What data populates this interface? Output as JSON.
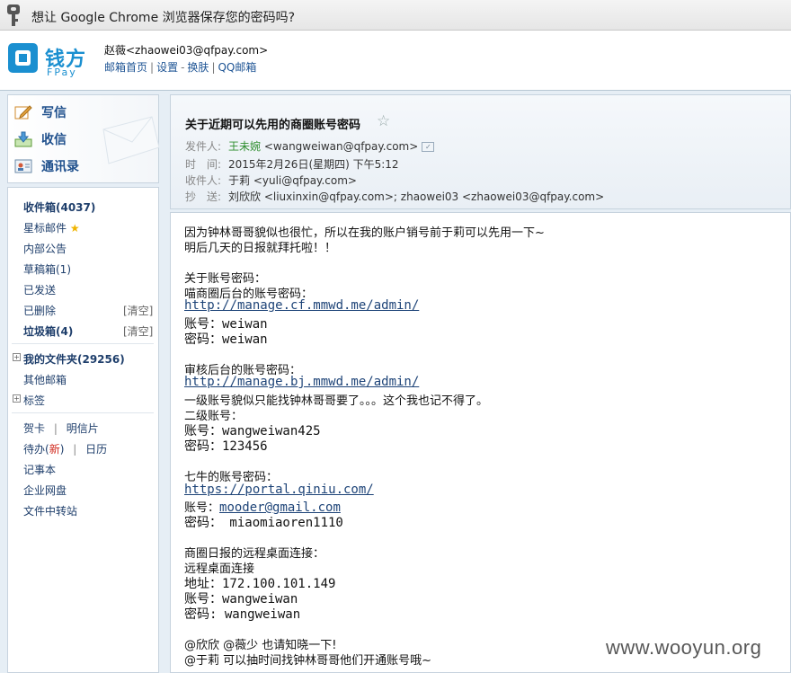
{
  "password_bar": {
    "message": "想让 Google Chrome 浏览器保存您的密码吗?"
  },
  "header": {
    "logo_cn": "钱方",
    "logo_en": "FPay",
    "user": "赵薇<zhaowei03@qfpay.com>",
    "nav": [
      "邮箱首页",
      "设置",
      "换肤",
      "QQ邮箱"
    ],
    "nav_seps": [
      "|",
      "-",
      "|"
    ]
  },
  "compose": {
    "write": "写信",
    "receive": "收信",
    "contacts": "通讯录"
  },
  "folders": {
    "inbox": "收件箱(4037)",
    "starred": "星标邮件",
    "internal": "内部公告",
    "drafts": "草稿箱(1)",
    "sent": "已发送",
    "deleted": "已删除",
    "junk": "垃圾箱(4)",
    "clear_label": "[清空]",
    "my_folders": "我的文件夹(29256)",
    "other_mailboxes": "其他邮箱",
    "tags": "标签",
    "greeting_card": "贺卡",
    "postcard": "明信片",
    "todo": "待办",
    "todo_new": "新",
    "calendar": "日历",
    "notepad": "记事本",
    "netdisk": "企业网盘",
    "transfer": "文件中转站",
    "pipe": "|"
  },
  "mail": {
    "subject": "关于近期可以先用的商圈账号密码",
    "from_label": "发件人:",
    "from_name": "王未婉",
    "from_addr": "<wangweiwan@qfpay.com>",
    "time_label": "时　间:",
    "time": "2015年2月26日(星期四) 下午5:12",
    "to_label": "收件人:",
    "to": "于莉 <yuli@qfpay.com>",
    "cc_label": "抄　送:",
    "cc": "刘欣欣 <liuxinxin@qfpay.com>; zhaowei03 <zhaowei03@qfpay.com>"
  },
  "body": {
    "l1": "因为钟林哥哥貌似也很忙，所以在我的账户销号前于莉可以先用一下~",
    "l2": "明后几天的日报就拜托啦！！",
    "l3": "关于账号密码：",
    "l4": "喵商圈后台的账号密码：",
    "link1": "http://manage.cf.mmwd.me/admin/",
    "l5": "账号：weiwan",
    "l6": "密码：weiwan",
    "l7": "审核后台的账号密码：",
    "link2": "http://manage.bj.mmwd.me/admin/",
    "l8": "一级账号貌似只能找钟林哥哥要了。。。这个我也记不得了。",
    "l9": "二级账号：",
    "l10": "账号：wangweiwan425",
    "l11": "密码：123456",
    "l12": "七牛的账号密码：",
    "link3": "https://portal.qiniu.com/",
    "l13_prefix": "账号：",
    "l13_link": "mooder@gmail.com",
    "l14": "密码：  miaomiaoren1110",
    "l15": "商圈日报的远程桌面连接：",
    "l16": "远程桌面连接",
    "l17": "地址：172.100.101.149",
    "l18": "账号：wangweiwan",
    "l19": "密码: wangweiwan",
    "l20": "@欣欣 @薇少 也请知晓一下!",
    "l21": "@于莉 可以抽时间找钟林哥哥他们开通账号哦~"
  },
  "watermark": "www.wooyun.org"
}
